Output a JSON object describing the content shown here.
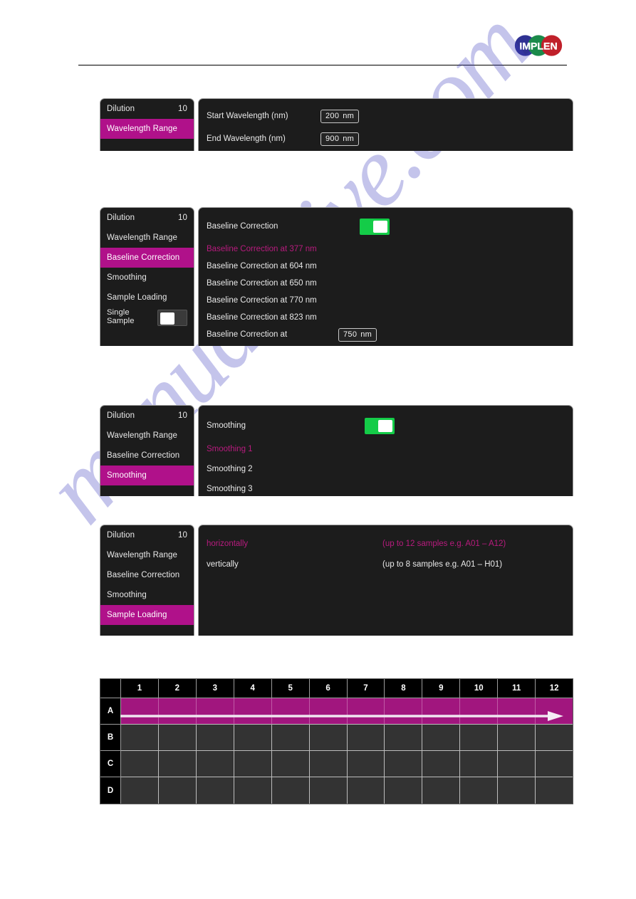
{
  "brand": {
    "logo_text": "IMPLEN",
    "colors": [
      "#2e3192",
      "#1a8a4a",
      "#c0202a"
    ]
  },
  "watermark": {
    "text": "manualshive.com"
  },
  "theme": {
    "panel_bg": "#1c1c1c",
    "accent_magenta": "#b0118a",
    "accent_pink_text": "#b81b7e",
    "toggle_on": "#14cc48",
    "text": "#e9e9e9"
  },
  "panels": [
    {
      "id": "wavelength-range",
      "sidebar": [
        {
          "label": "Dilution",
          "value": "10",
          "selected": false
        },
        {
          "label": "Wavelength Range",
          "value": "",
          "selected": true
        }
      ],
      "rows": [
        {
          "label": "Start Wavelength (nm)",
          "pink": false,
          "input": {
            "value": "200",
            "unit": "nm"
          }
        },
        {
          "label": "End Wavelength (nm)",
          "pink": false,
          "input": {
            "value": "900",
            "unit": "nm"
          }
        }
      ]
    },
    {
      "id": "baseline-correction",
      "sidebar": [
        {
          "label": "Dilution",
          "value": "10",
          "selected": false
        },
        {
          "label": "Wavelength Range",
          "value": "",
          "selected": false
        },
        {
          "label": "Baseline Correction",
          "value": "",
          "selected": true
        },
        {
          "label": "Smoothing",
          "value": "",
          "selected": false
        },
        {
          "label": "Sample Loading",
          "value": "",
          "selected": false
        },
        {
          "label": "Single Sample",
          "value": "",
          "selected": false,
          "toggle": "off"
        }
      ],
      "rows": [
        {
          "label": "Baseline Correction",
          "pink": false,
          "toggle": "on"
        },
        {
          "label": "Baseline Correction at 377 nm",
          "pink": true
        },
        {
          "label": "Baseline Correction at 604 nm",
          "pink": false
        },
        {
          "label": "Baseline Correction at 650 nm",
          "pink": false
        },
        {
          "label": "Baseline Correction at 770 nm",
          "pink": false
        },
        {
          "label": "Baseline Correction at 823 nm",
          "pink": false
        },
        {
          "label": "Baseline Correction at",
          "pink": false,
          "input": {
            "value": "750",
            "unit": "nm"
          }
        }
      ]
    },
    {
      "id": "smoothing",
      "sidebar": [
        {
          "label": "Dilution",
          "value": "10",
          "selected": false
        },
        {
          "label": "Wavelength Range",
          "value": "",
          "selected": false
        },
        {
          "label": "Baseline Correction",
          "value": "",
          "selected": false
        },
        {
          "label": "Smoothing",
          "value": "",
          "selected": true
        }
      ],
      "rows": [
        {
          "label": "Smoothing",
          "pink": false,
          "toggle": "on"
        },
        {
          "label": "Smoothing  1",
          "pink": true
        },
        {
          "label": "Smoothing  2",
          "pink": false
        },
        {
          "label": "Smoothing  3",
          "pink": false
        }
      ]
    },
    {
      "id": "sample-loading",
      "sidebar": [
        {
          "label": "Dilution",
          "value": "10",
          "selected": false
        },
        {
          "label": "Wavelength Range",
          "value": "",
          "selected": false
        },
        {
          "label": "Baseline Correction",
          "value": "",
          "selected": false
        },
        {
          "label": "Smoothing",
          "value": "",
          "selected": false
        },
        {
          "label": "Sample Loading",
          "value": "",
          "selected": true
        }
      ],
      "rows": [
        {
          "label": "horizontally",
          "hint": "(up to 12 samples e.g. A01 – A12)",
          "pink": true
        },
        {
          "label": "vertically",
          "hint": "(up to 8 samples e.g. A01 – H01)",
          "pink": false
        }
      ]
    }
  ],
  "plate": {
    "columns": [
      "1",
      "2",
      "3",
      "4",
      "5",
      "6",
      "7",
      "8",
      "9",
      "10",
      "11",
      "12"
    ],
    "rows": [
      "A",
      "B",
      "C",
      "D"
    ],
    "selected_row": "A",
    "direction_arrow": "right"
  }
}
